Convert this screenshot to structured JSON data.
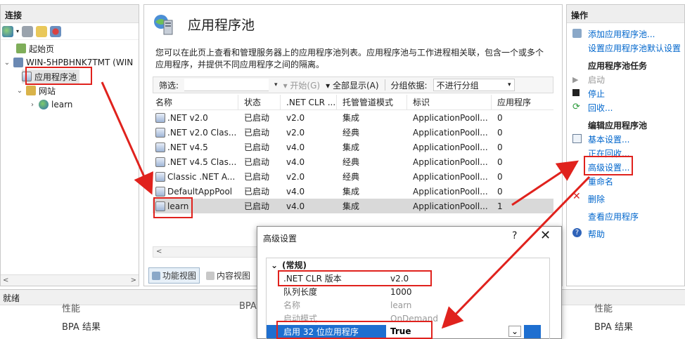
{
  "left": {
    "header": "连接",
    "tree": [
      {
        "label": "起始页"
      },
      {
        "label": "WIN-5HPBHNK7TMT (WIN"
      },
      {
        "label": "应用程序池"
      },
      {
        "label": "网站"
      },
      {
        "label": "learn"
      }
    ],
    "scroll_left": "<",
    "scroll_right": ">"
  },
  "center": {
    "title": "应用程序池",
    "description": "您可以在此页上查看和管理服务器上的应用程序池列表。应用程序池与工作进程相关联，包含一个或多个应用程序，并提供不同应用程序之间的隔离。",
    "filter": {
      "label": "筛选:",
      "start_label": "开始(G)",
      "show_all_label": "全部显示(A)",
      "group_label": "分组依据:",
      "group_value": "不进行分组"
    },
    "columns": [
      "名称",
      "状态",
      ".NET CLR ...",
      "托管管道模式",
      "标识",
      "应用程序"
    ],
    "rows": [
      {
        "name": ".NET v2.0",
        "status": "已启动",
        "clr": "v2.0",
        "pipeline": "集成",
        "identity": "ApplicationPooll...",
        "apps": "0"
      },
      {
        "name": ".NET v2.0 Clas...",
        "status": "已启动",
        "clr": "v2.0",
        "pipeline": "经典",
        "identity": "ApplicationPooll...",
        "apps": "0"
      },
      {
        "name": ".NET v4.5",
        "status": "已启动",
        "clr": "v4.0",
        "pipeline": "集成",
        "identity": "ApplicationPooll...",
        "apps": "0"
      },
      {
        "name": ".NET v4.5 Clas...",
        "status": "已启动",
        "clr": "v4.0",
        "pipeline": "经典",
        "identity": "ApplicationPooll...",
        "apps": "0"
      },
      {
        "name": "Classic .NET A...",
        "status": "已启动",
        "clr": "v2.0",
        "pipeline": "经典",
        "identity": "ApplicationPooll...",
        "apps": "0"
      },
      {
        "name": "DefaultAppPool",
        "status": "已启动",
        "clr": "v4.0",
        "pipeline": "集成",
        "identity": "ApplicationPooll...",
        "apps": "0"
      },
      {
        "name": "learn",
        "status": "已启动",
        "clr": "v4.0",
        "pipeline": "集成",
        "identity": "ApplicationPooll...",
        "apps": "1"
      }
    ],
    "scroll_left": "<",
    "tabs": {
      "features": "功能视图",
      "content": "内容视图"
    }
  },
  "right": {
    "header": "操作",
    "add_pool": "添加应用程序池...",
    "set_defaults": "设置应用程序池默认设置",
    "pool_tasks": "应用程序池任务",
    "start": "启动",
    "stop": "停止",
    "recycle": "回收...",
    "edit_pool": "编辑应用程序池",
    "basic": "基本设置...",
    "recycling": "正在回收...",
    "advanced": "高级设置...",
    "rename": "重命名",
    "delete": "删除",
    "view_apps": "查看应用程序",
    "help": "帮助"
  },
  "status_bar": {
    "text": "就绪"
  },
  "bottom": {
    "perf1": "性能",
    "bpa_partial": "BPA",
    "perf2": "性能",
    "bpa_result1": "BPA 结果",
    "bpa_result2": "BPA 结果"
  },
  "dialog": {
    "title": "高级设置",
    "help": "?",
    "close": "✕",
    "section": "(常规)",
    "props": [
      {
        "name": ".NET CLR 版本",
        "value": "v2.0"
      },
      {
        "name": "队列长度",
        "value": "1000"
      },
      {
        "name": "名称",
        "value": "learn"
      },
      {
        "name": "启动模式",
        "value": "OnDemand"
      },
      {
        "name": "启用 32 位应用程序",
        "value": "True"
      }
    ],
    "dropdown": "⌄"
  },
  "colors": {
    "annotation_red": "#e0221d",
    "selection_blue": "#1e6fd0",
    "link_blue": "#0066cc"
  }
}
